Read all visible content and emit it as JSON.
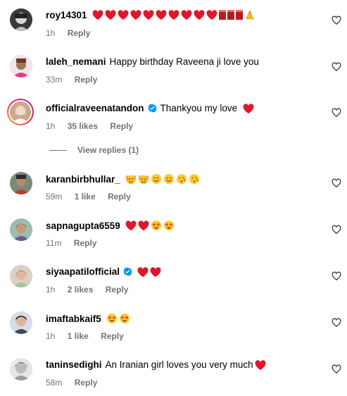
{
  "colors": {
    "heart": "#e0162b",
    "verified": "#0095f6",
    "muted": "#737373"
  },
  "comments": [
    {
      "username": "roy14301",
      "text": "",
      "time": "1h",
      "likes": "",
      "reply": "Reply",
      "emojis": [
        "heart",
        "heart",
        "heart",
        "heart",
        "heart",
        "heart",
        "heart",
        "heart",
        "heart",
        "heart",
        "flag-red",
        "flag-red",
        "flag-red",
        "folded-hands"
      ]
    },
    {
      "username": "laleh_nemani",
      "text": "Happy birthday Raveena ji love you",
      "time": "33m",
      "likes": "",
      "reply": "Reply",
      "emojis": []
    },
    {
      "username": "officialraveenatandon",
      "verified": true,
      "text": "Thankyou my love",
      "time": "1h",
      "likes": "35 likes",
      "reply": "Reply",
      "emojis": [
        "heart"
      ]
    },
    {
      "username": "karanbirbhullar_",
      "text": "",
      "time": "59m",
      "likes": "1 like",
      "reply": "Reply",
      "emojis": [
        "raising-hands-face",
        "raising-hands-face",
        "smiling-face",
        "smiling-face",
        "kiss-face",
        "kiss-face"
      ]
    },
    {
      "username": "sapnagupta6559",
      "text": "",
      "time": "11m",
      "likes": "",
      "reply": "Reply",
      "emojis": [
        "heart",
        "heart",
        "star-eyes-face",
        "star-eyes-face"
      ]
    },
    {
      "username": "siyaapatilofficial",
      "verified": true,
      "text": "",
      "time": "1h",
      "likes": "2 likes",
      "reply": "Reply",
      "emojis": [
        "heart",
        "heart"
      ]
    },
    {
      "username": "imaftabkaif5",
      "text": "",
      "time": "1h",
      "likes": "1 like",
      "reply": "Reply",
      "emojis": [
        "star-eyes-face",
        "star-eyes-face"
      ]
    },
    {
      "username": "taninsedighi",
      "text": "An Iranian girl loves you very much",
      "time": "58m",
      "likes": "",
      "reply": "Reply",
      "emojis": [
        "heart"
      ]
    }
  ],
  "view_replies": "View replies (1)"
}
